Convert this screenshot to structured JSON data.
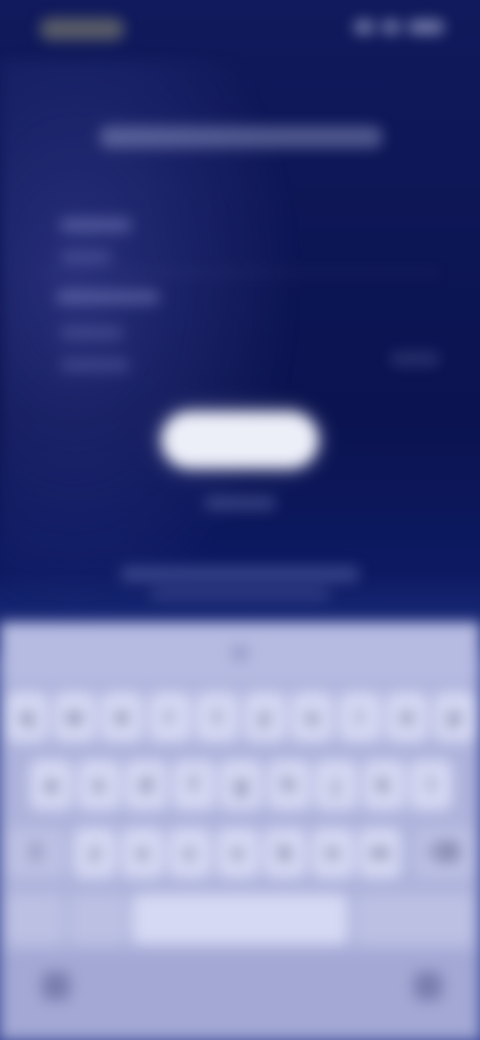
{
  "status_bar": {
    "time": "",
    "icons": [
      "signal-icon",
      "wifi-icon",
      "battery-icon"
    ]
  },
  "form": {
    "title": "",
    "fields": [
      {
        "label": "",
        "value": ""
      },
      {
        "label": "",
        "value": ""
      }
    ],
    "primary_button": "",
    "secondary_link": "",
    "footer_text": ""
  },
  "keyboard": {
    "row1": [
      "q",
      "w",
      "e",
      "r",
      "t",
      "y",
      "u",
      "i",
      "o",
      "p"
    ],
    "row2": [
      "a",
      "s",
      "d",
      "f",
      "g",
      "h",
      "j",
      "k",
      "l"
    ],
    "row3": [
      "z",
      "x",
      "c",
      "v",
      "b",
      "n",
      "m"
    ],
    "shift_icon": "shift-icon",
    "backspace_icon": "backspace-icon",
    "space_label": "",
    "return_label": "",
    "emoji_icon": "emoji-icon",
    "mic_icon": "mic-icon"
  }
}
